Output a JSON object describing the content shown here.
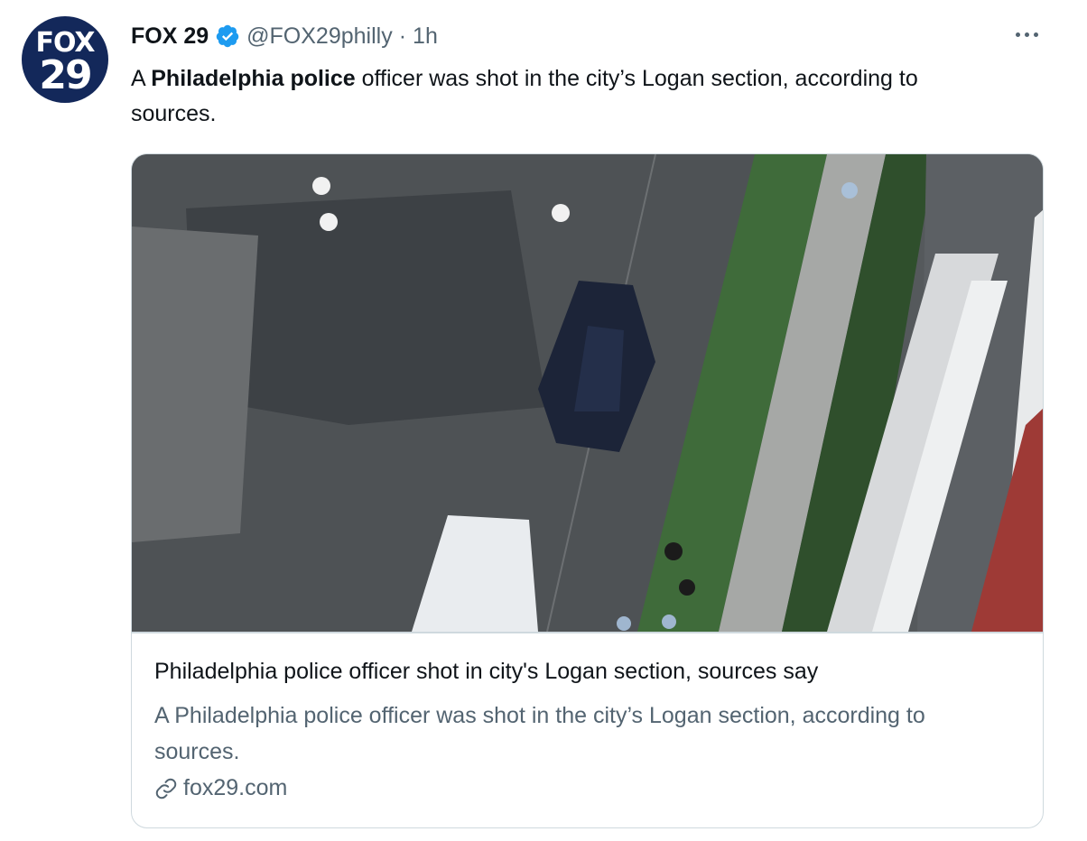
{
  "tweet": {
    "avatar": {
      "logo_line1": "FOX",
      "logo_line2": "29"
    },
    "display_name": "FOX 29",
    "verified_icon": "verified-badge-icon",
    "handle": "@FOX29philly",
    "separator": "·",
    "time": "1h",
    "text_parts": {
      "pre": "A ",
      "bold": "Philadelphia police",
      "post": " officer was shot in the city’s Logan section, according to sources."
    }
  },
  "card": {
    "title": "Philadelphia police officer shot in city's Logan section, sources say",
    "description": "A Philadelphia police officer was shot in the city’s Logan section, according to sources.",
    "link_icon": "link-icon",
    "domain": "fox29.com"
  },
  "colors": {
    "accent": "#1d9bf0",
    "text": "#0f1419",
    "muted": "#536471",
    "border": "#cfd9de",
    "avatar_bg": "#13285a"
  }
}
